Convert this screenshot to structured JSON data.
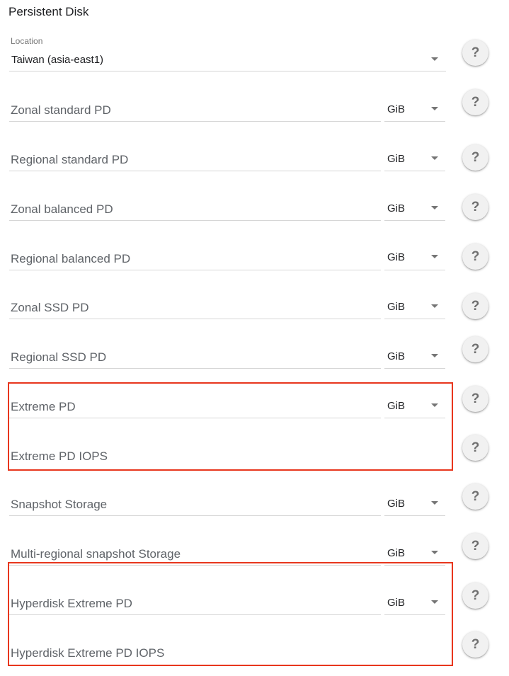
{
  "section_title": "Persistent Disk",
  "location": {
    "label": "Location",
    "value": "Taiwan (asia-east1)"
  },
  "help_glyph": "?",
  "fields": [
    {
      "label": "Zonal standard PD",
      "unit": "GiB"
    },
    {
      "label": "Regional standard PD",
      "unit": "GiB"
    },
    {
      "label": "Zonal balanced PD",
      "unit": "GiB"
    },
    {
      "label": "Regional balanced PD",
      "unit": "GiB"
    },
    {
      "label": "Zonal SSD PD",
      "unit": "GiB"
    },
    {
      "label": "Regional SSD PD",
      "unit": "GiB"
    },
    {
      "label": "Extreme PD",
      "unit": "GiB"
    },
    {
      "label": "Extreme PD IOPS"
    },
    {
      "label": "Snapshot Storage",
      "unit": "GiB"
    },
    {
      "label": "Multi-regional snapshot Storage",
      "unit": "GiB"
    },
    {
      "label": "Hyperdisk Extreme PD",
      "unit": "GiB"
    },
    {
      "label": "Hyperdisk Extreme PD IOPS"
    }
  ],
  "colors": {
    "highlight_border": "#e8361d",
    "underline": "#d6d6d6",
    "label_text": "#5f6368"
  },
  "icons": {
    "help": "help-question-icon",
    "dropdown": "dropdown-arrow-icon"
  }
}
